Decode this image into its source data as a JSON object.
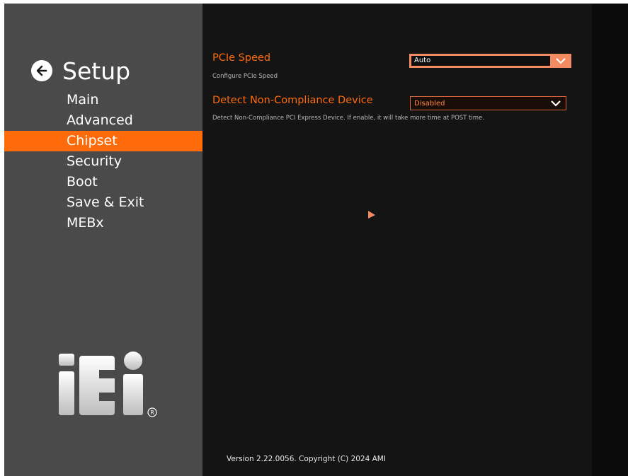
{
  "sidebar": {
    "title": "Setup",
    "back_icon": "arrow-left-icon",
    "items": [
      {
        "label": "Main"
      },
      {
        "label": "Advanced"
      },
      {
        "label": "Chipset"
      },
      {
        "label": "Security"
      },
      {
        "label": "Boot"
      },
      {
        "label": "Save & Exit"
      },
      {
        "label": "MEBx"
      }
    ],
    "active_item": "Chipset",
    "logo_text": "iEi",
    "logo_mark": "®"
  },
  "options": [
    {
      "label": "PCIe Speed",
      "help": "Configure PCIe Speed",
      "value": "Auto",
      "state": "focused"
    },
    {
      "label": "Detect Non-Compliance Device",
      "help": "Detect Non-Compliance PCI Express Device. If enable, it will take more time at POST time.",
      "value": "Disabled",
      "state": "normal"
    }
  ],
  "footer": {
    "version": "Version 2.22.0056. Copyright (C) 2024 AMI"
  },
  "colors": {
    "accent": "#ff6a0a",
    "sidebar_bg": "#4a4a4a",
    "content_bg": "#141414",
    "focused_select": "#f28a62"
  }
}
